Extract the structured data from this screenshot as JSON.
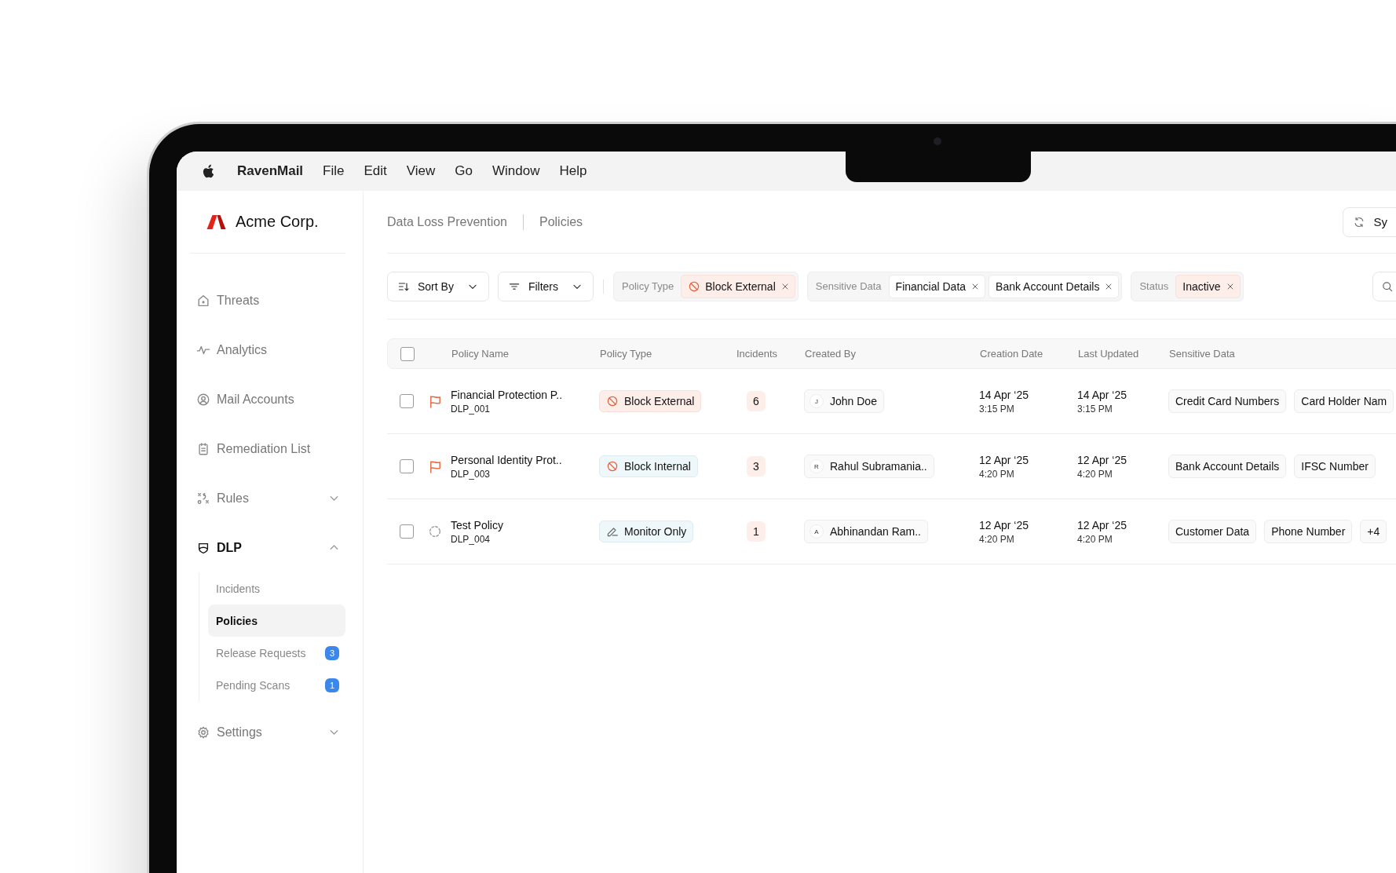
{
  "menu_bar": {
    "app_name": "RavenMail",
    "menus": [
      "File",
      "Edit",
      "View",
      "Go",
      "Window",
      "Help"
    ]
  },
  "sidebar": {
    "brand": "Acme Corp.",
    "items": [
      {
        "label": "Threats",
        "selected": false
      },
      {
        "label": "Analytics",
        "selected": false
      },
      {
        "label": "Mail Accounts",
        "selected": false
      },
      {
        "label": "Remediation List",
        "selected": false
      },
      {
        "label": "Rules",
        "selected": false,
        "expanded": false
      },
      {
        "label": "DLP",
        "selected": true,
        "expanded": true,
        "children": [
          {
            "label": "Incidents",
            "selected": false
          },
          {
            "label": "Policies",
            "selected": true
          },
          {
            "label": "Release Requests",
            "selected": false,
            "badge": "3"
          },
          {
            "label": "Pending Scans",
            "selected": false,
            "badge": "1"
          }
        ]
      },
      {
        "label": "Settings",
        "selected": false,
        "expanded": false
      }
    ]
  },
  "header": {
    "breadcrumb": [
      "Data Loss Prevention",
      "Policies"
    ],
    "sync_button": "Sy"
  },
  "toolbar": {
    "sort_button": "Sort By",
    "filter_button": "Filters",
    "filter_groups": [
      {
        "label": "Policy Type",
        "chips": [
          {
            "label": "Block External",
            "kind": "block"
          }
        ]
      },
      {
        "label": "Sensitive Data",
        "chips": [
          {
            "label": "Financial Data",
            "kind": "plain"
          },
          {
            "label": "Bank Account Details",
            "kind": "plain"
          }
        ]
      },
      {
        "label": "Status",
        "chips": [
          {
            "label": "Inactive",
            "kind": "status"
          }
        ]
      }
    ]
  },
  "table": {
    "all_checked": false,
    "columns": [
      "Policy Name",
      "Policy Type",
      "Incidents",
      "Created By",
      "Creation Date",
      "Last Updated",
      "Sensitive Data"
    ],
    "rows": [
      {
        "checked": false,
        "flagged": true,
        "name": "Financial Protection P..",
        "id": "DLP_001",
        "policy_type": {
          "label": "Block External",
          "kind": "block_external"
        },
        "incidents": "6",
        "created_by": {
          "initial": "J",
          "name": "John Doe"
        },
        "created": {
          "date": "14 Apr ‘25",
          "time": "3:15 PM"
        },
        "updated": {
          "date": "14 Apr ‘25",
          "time": "3:15 PM"
        },
        "sensitive_data": [
          "Credit Card Numbers",
          "Card Holder Nam"
        ]
      },
      {
        "checked": false,
        "flagged": true,
        "name": "Personal Identity Prot..",
        "id": "DLP_003",
        "policy_type": {
          "label": "Block Internal",
          "kind": "block_internal"
        },
        "incidents": "3",
        "created_by": {
          "initial": "R",
          "name": "Rahul Subramania.."
        },
        "created": {
          "date": "12 Apr ‘25",
          "time": "4:20 PM"
        },
        "updated": {
          "date": "12 Apr ‘25",
          "time": "4:20 PM"
        },
        "sensitive_data": [
          "Bank Account Details",
          "IFSC Number"
        ]
      },
      {
        "checked": false,
        "flagged": false,
        "name": "Test Policy",
        "id": "DLP_004",
        "policy_type": {
          "label": "Monitor Only",
          "kind": "monitor"
        },
        "incidents": "1",
        "created_by": {
          "initial": "A",
          "name": "Abhinandan Ram.."
        },
        "created": {
          "date": "12 Apr ‘25",
          "time": "4:20 PM"
        },
        "updated": {
          "date": "12 Apr ‘25",
          "time": "4:20 PM"
        },
        "sensitive_data": [
          "Customer Data",
          "Phone Number",
          "+4"
        ]
      }
    ]
  }
}
